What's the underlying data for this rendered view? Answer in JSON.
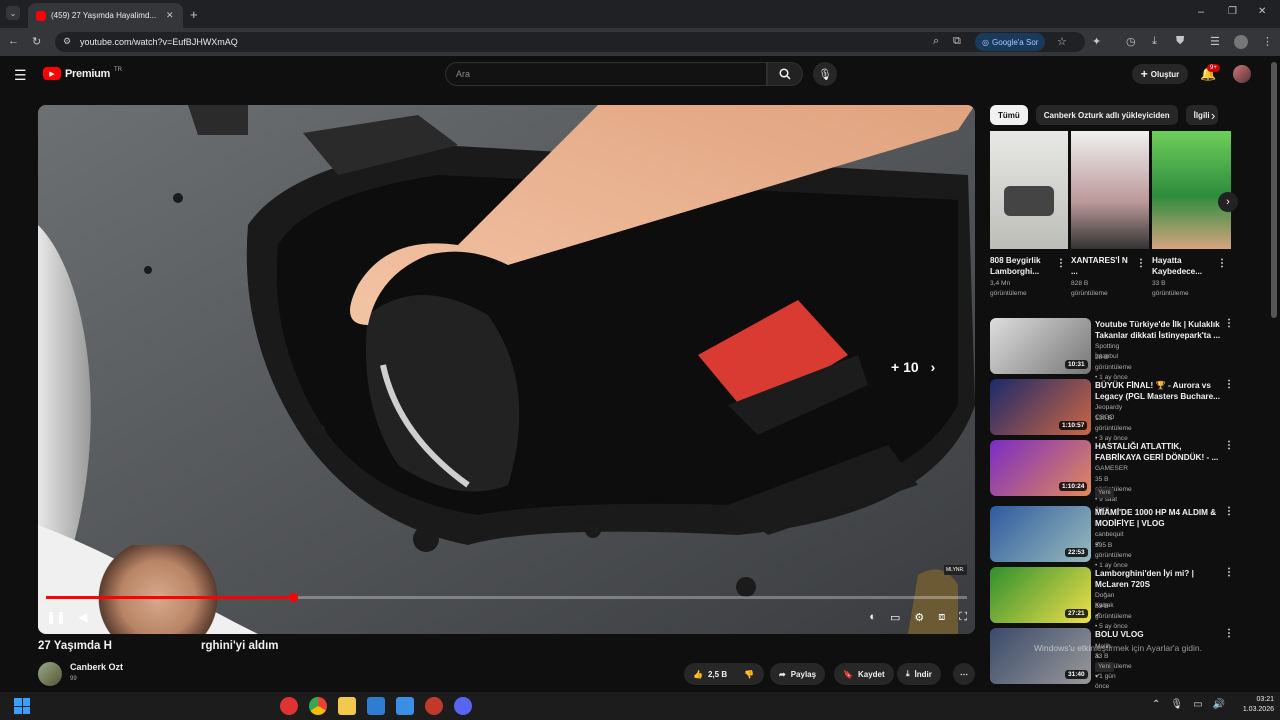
{
  "browser": {
    "tab_title": "(459) 27 Yaşımda Hayalimd...",
    "url": "youtube.com/watch?v=EufBJHWXmAQ",
    "google_btn": "Google'a Sor"
  },
  "yt": {
    "logo_text": "Premium",
    "logo_region": "TR",
    "search_placeholder": "Ara",
    "create_label": "Oluştur",
    "notif_count": "9+"
  },
  "player": {
    "seek_label": "+ 10",
    "progress_fraction": 0.268,
    "channel_chip": "MLYNR."
  },
  "video": {
    "title_left": "27 Yaşımda H",
    "title_right": "rghini'yi aldım",
    "channel": "Canberk Ozt",
    "subs": "99",
    "likes": "2,5 B",
    "share": "Paylaş",
    "save": "Kaydet",
    "download": "İndir"
  },
  "filters": [
    "Tümü",
    "Canberk Ozturk adlı yükleyiciden",
    "İlgili"
  ],
  "shorts": [
    {
      "title": "808 Beygirlik Lamborghi...",
      "views": "3,4 Mn",
      "views2": "görüntüleme"
    },
    {
      "title": "XANTARES'İ N ...",
      "views": "828 B",
      "views2": "görüntüleme"
    },
    {
      "title": "Hayatta Kaybedece...",
      "views": "33 B",
      "views2": "görüntüleme"
    }
  ],
  "related": [
    {
      "title": "Youtube Türkiye'de İlk | Kulaklık Takanlar dikkati İstinyepark'ta ...",
      "channel": "Spotting İstanbul",
      "meta": "28 B görüntüleme • 1 ay önce",
      "duration": "10:31",
      "badge": "",
      "verified": false
    },
    {
      "title": "BÜYÜK FİNAL! 🏆 - Aurora vs Legacy (PGL Masters Buchare...",
      "channel": "Jeopardy CSGO",
      "meta": "130 B görüntüleme • 3 ay önce",
      "duration": "1:10:57",
      "badge": "",
      "verified": false
    },
    {
      "title": "HASTALIĞI ATLATTIK, FABRİKAYA GERİ DÖNDÜK! - ...",
      "channel": "GAMESER",
      "meta": "35 B görüntüleme • 9 saat önce",
      "duration": "1:10:24",
      "badge": "Yeni",
      "verified": false
    },
    {
      "title": "MİAMİ'DE 1000 HP M4 ALDIM & MODİFİYE | VLOG",
      "channel": "canbequit",
      "meta": "595 B görüntüleme • 1 ay önce",
      "duration": "22:53",
      "badge": "",
      "verified": true
    },
    {
      "title": "Lamborghini'den İyi mi? | McLaren 720S",
      "channel": "Doğan Kabak",
      "meta": "89 B görüntüleme • 5 ay önce",
      "duration": "27:21",
      "badge": "",
      "verified": true
    },
    {
      "title": "BOLU VLOG",
      "channel": "Melih & Erkan",
      "meta": "33 B görüntüleme • 1 gün önce",
      "duration": "31:40",
      "badge": "Yeni",
      "verified": true
    }
  ],
  "overlay_text": "Windows'u etkinleştirmek için Ayarlar'a gidin.",
  "taskbar": {
    "time": "03:21",
    "date": "1.03.2026"
  },
  "colors": {
    "accent": "#ff0000",
    "bg": "#0f0f0f"
  }
}
